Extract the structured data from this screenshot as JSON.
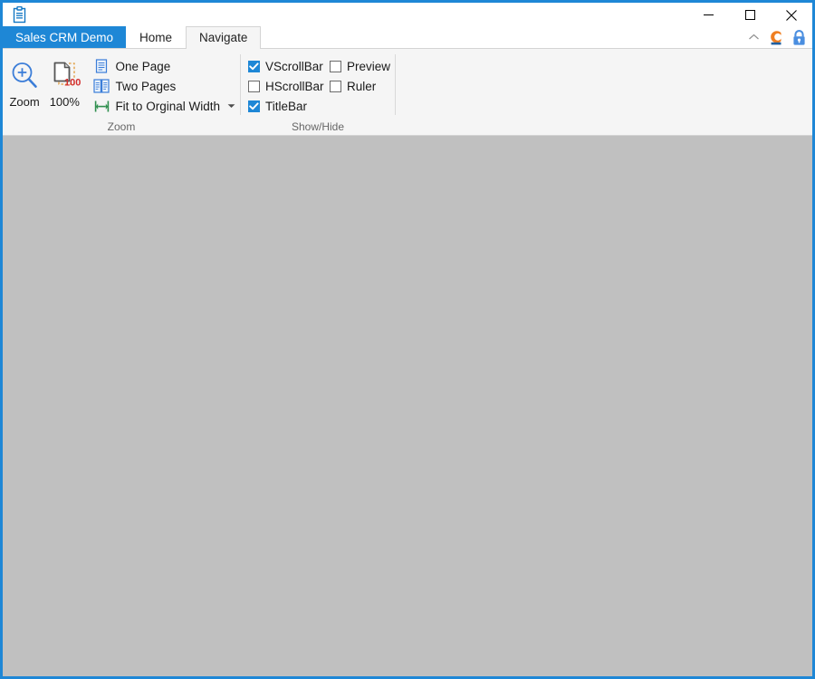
{
  "window": {
    "title": "",
    "app_icon": "clipboard-icon",
    "controls": {
      "minimize": "minimize-icon",
      "maximize": "maximize-icon",
      "close": "close-icon"
    }
  },
  "tabs": [
    {
      "label": "Sales CRM Demo",
      "kind": "app",
      "selected": false
    },
    {
      "label": "Home",
      "kind": "normal",
      "selected": false
    },
    {
      "label": "Navigate",
      "kind": "normal",
      "selected": true
    }
  ],
  "ribbon_right_icons": [
    {
      "name": "chevron-up-icon",
      "title": "Collapse the Ribbon"
    },
    {
      "name": "brand-logo-icon",
      "title": ""
    },
    {
      "name": "lock-icon",
      "title": ""
    }
  ],
  "ribbon": {
    "groups": [
      {
        "label": "Zoom",
        "big_buttons": [
          {
            "label": "Zoom",
            "icon": "zoom-in-magnifier-icon"
          },
          {
            "label": "100%",
            "icon": "zoom-100-page-icon",
            "badge": "100"
          }
        ],
        "small_buttons": [
          {
            "label": "One Page",
            "icon": "one-page-icon",
            "has_dropdown": false
          },
          {
            "label": "Two Pages",
            "icon": "two-pages-icon",
            "has_dropdown": false
          },
          {
            "label": "Fit to Orginal Width",
            "icon": "fit-width-icon",
            "has_dropdown": true
          }
        ]
      },
      {
        "label": "Show/Hide",
        "checkboxes": [
          {
            "label": "VScrollBar",
            "checked": true
          },
          {
            "label": "Preview",
            "checked": false
          },
          {
            "label": "HScrollBar",
            "checked": false
          },
          {
            "label": "Ruler",
            "checked": false
          },
          {
            "label": "TitleBar",
            "checked": true
          }
        ]
      }
    ]
  },
  "colors": {
    "accent_blue": "#1e87d6",
    "ribbon_background": "#f5f5f5",
    "client_background": "#c0c0c0",
    "brand_orange": "#ef7f22",
    "brand_blue": "#1f5fa0",
    "badge_red": "#d32f2f"
  }
}
